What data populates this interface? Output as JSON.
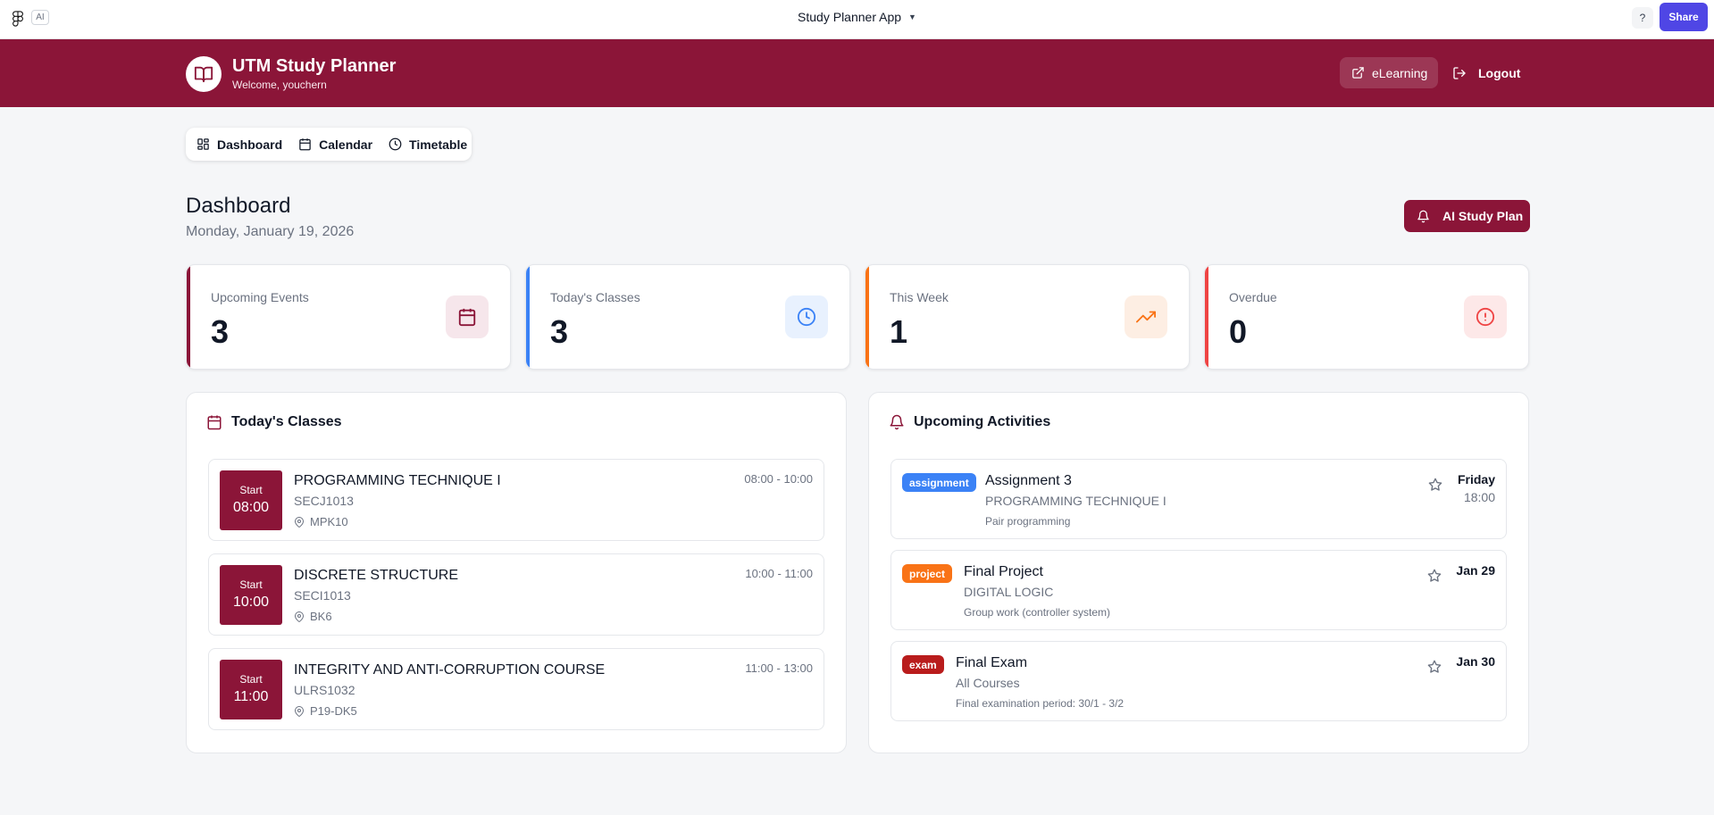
{
  "figma_bar": {
    "ai_chip": "AI",
    "app_title": "Study Planner App",
    "help_label": "?",
    "share_label": "Share"
  },
  "header": {
    "title": "UTM Study Planner",
    "subtitle": "Welcome, youchern",
    "elearning_label": "eLearning",
    "logout_label": "Logout",
    "brand_color": "#8b1538"
  },
  "nav": {
    "items": [
      {
        "label": "Dashboard",
        "icon": "grid-icon"
      },
      {
        "label": "Calendar",
        "icon": "calendar-icon"
      },
      {
        "label": "Timetable",
        "icon": "clock-icon"
      }
    ]
  },
  "dashboard": {
    "title": "Dashboard",
    "date": "Monday, January 19, 2026",
    "ai_button_label": "AI Study Plan"
  },
  "stats": [
    {
      "label": "Upcoming Events",
      "value": "3",
      "icon": "calendar-icon",
      "accent": "#8b1538"
    },
    {
      "label": "Today's Classes",
      "value": "3",
      "icon": "clock-icon",
      "accent": "#3b82f6"
    },
    {
      "label": "This Week",
      "value": "1",
      "icon": "trending-up-icon",
      "accent": "#f97316"
    },
    {
      "label": "Overdue",
      "value": "0",
      "icon": "alert-circle-icon",
      "accent": "#ef4444"
    }
  ],
  "todays_classes": {
    "title": "Today's Classes",
    "items": [
      {
        "start_label": "Start",
        "start": "08:00",
        "name": "PROGRAMMING TECHNIQUE I",
        "code": "SECJ1013",
        "room": "MPK10",
        "time": "08:00 - 10:00"
      },
      {
        "start_label": "Start",
        "start": "10:00",
        "name": "DISCRETE STRUCTURE",
        "code": "SECI1013",
        "room": "BK6",
        "time": "10:00 - 11:00"
      },
      {
        "start_label": "Start",
        "start": "11:00",
        "name": "INTEGRITY AND ANTI-CORRUPTION COURSE",
        "code": "ULRS1032",
        "room": "P19-DK5",
        "time": "11:00 - 13:00"
      }
    ]
  },
  "upcoming_activities": {
    "title": "Upcoming Activities",
    "items": [
      {
        "badge": "assignment",
        "badge_color": "#3b82f6",
        "title": "Assignment 3",
        "course": "PROGRAMMING TECHNIQUE I",
        "note": "Pair programming",
        "due": "Friday",
        "due_time": "18:00"
      },
      {
        "badge": "project",
        "badge_color": "#f97316",
        "title": "Final Project",
        "course": "DIGITAL LOGIC",
        "note": "Group work (controller system)",
        "due": "Jan 29",
        "due_time": ""
      },
      {
        "badge": "exam",
        "badge_color": "#b91c1c",
        "title": "Final Exam",
        "course": "All Courses",
        "note": "Final examination period: 30/1 - 3/2",
        "due": "Jan 30",
        "due_time": ""
      }
    ]
  }
}
